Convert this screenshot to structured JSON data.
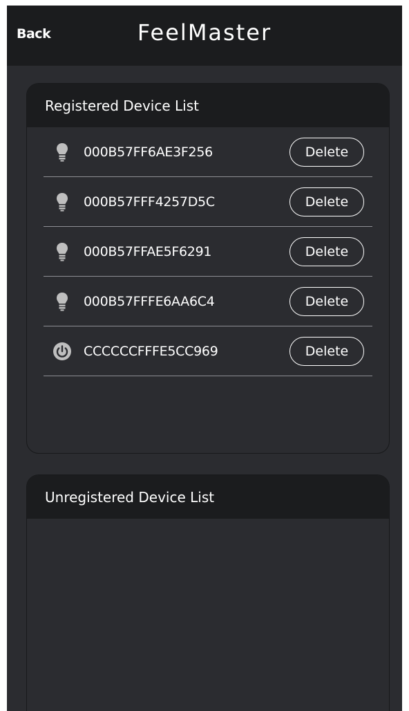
{
  "header": {
    "back_label": "Back",
    "app_title": "FeelMaster"
  },
  "registered": {
    "title": "Registered Device List",
    "devices": [
      {
        "id": "000B57FF6AE3F256",
        "icon": "lightbulb-icon",
        "delete_label": "Delete"
      },
      {
        "id": "000B57FFF4257D5C",
        "icon": "lightbulb-icon",
        "delete_label": "Delete"
      },
      {
        "id": "000B57FFAE5F6291",
        "icon": "lightbulb-icon",
        "delete_label": "Delete"
      },
      {
        "id": "000B57FFFE6AA6C4",
        "icon": "lightbulb-icon",
        "delete_label": "Delete"
      },
      {
        "id": "CCCCCCFFFE5CC969",
        "icon": "power-icon",
        "delete_label": "Delete"
      }
    ]
  },
  "unregistered": {
    "title": "Unregistered Device List",
    "devices": []
  },
  "colors": {
    "background": "#2b2c30",
    "header": "#1b1c1e",
    "text": "#ffffff",
    "divider": "#8e8f94",
    "icon": "#bfbfbf"
  }
}
